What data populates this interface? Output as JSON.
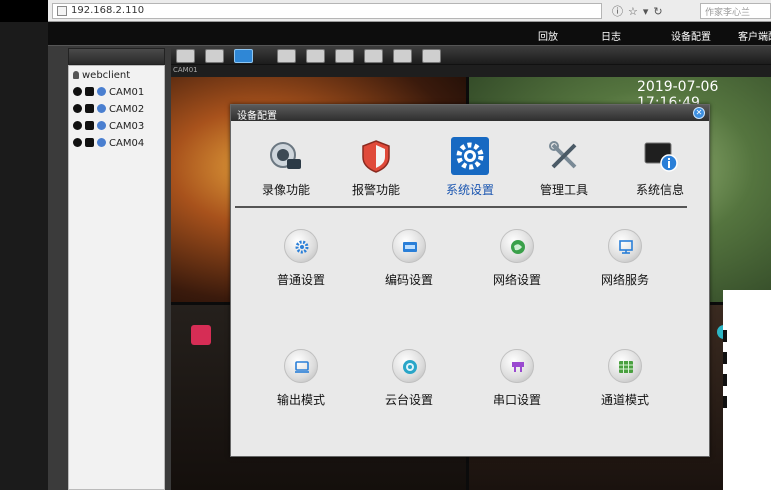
{
  "browser": {
    "address": "192.168.2.110",
    "search_placeholder": "作家李心兰"
  },
  "topnav": {
    "items": [
      "回放",
      "日志",
      "设备配置",
      "客户端配置"
    ]
  },
  "sidebar": {
    "client_label": "webclient",
    "cameras": [
      "CAM01",
      "CAM02",
      "CAM03",
      "CAM04"
    ]
  },
  "video": {
    "channel_label": "CAM01",
    "osd_time": "2019-07-06 17:16:49"
  },
  "dialog": {
    "title": "设备配置",
    "tabs": [
      {
        "label": "录像功能",
        "icon": "camera-record-icon"
      },
      {
        "label": "报警功能",
        "icon": "alarm-shield-icon"
      },
      {
        "label": "系统设置",
        "icon": "system-settings-icon"
      },
      {
        "label": "管理工具",
        "icon": "tools-icon"
      },
      {
        "label": "系统信息",
        "icon": "system-info-icon"
      }
    ],
    "active_tab": "系统设置",
    "functions": [
      {
        "label": "普通设置",
        "icon": "gear-icon"
      },
      {
        "label": "编码设置",
        "icon": "encoding-icon"
      },
      {
        "label": "网络设置",
        "icon": "network-icon"
      },
      {
        "label": "网络服务",
        "icon": "network-service-icon"
      },
      {
        "label": "输出模式",
        "icon": "monitor-icon"
      },
      {
        "label": "云台设置",
        "icon": "ptz-icon"
      },
      {
        "label": "串口设置",
        "icon": "serial-port-icon"
      },
      {
        "label": "通道模式",
        "icon": "channel-grid-icon"
      }
    ]
  },
  "colors": {
    "accent": "#1769c2",
    "dialog_bg": "#e9e9e9"
  }
}
